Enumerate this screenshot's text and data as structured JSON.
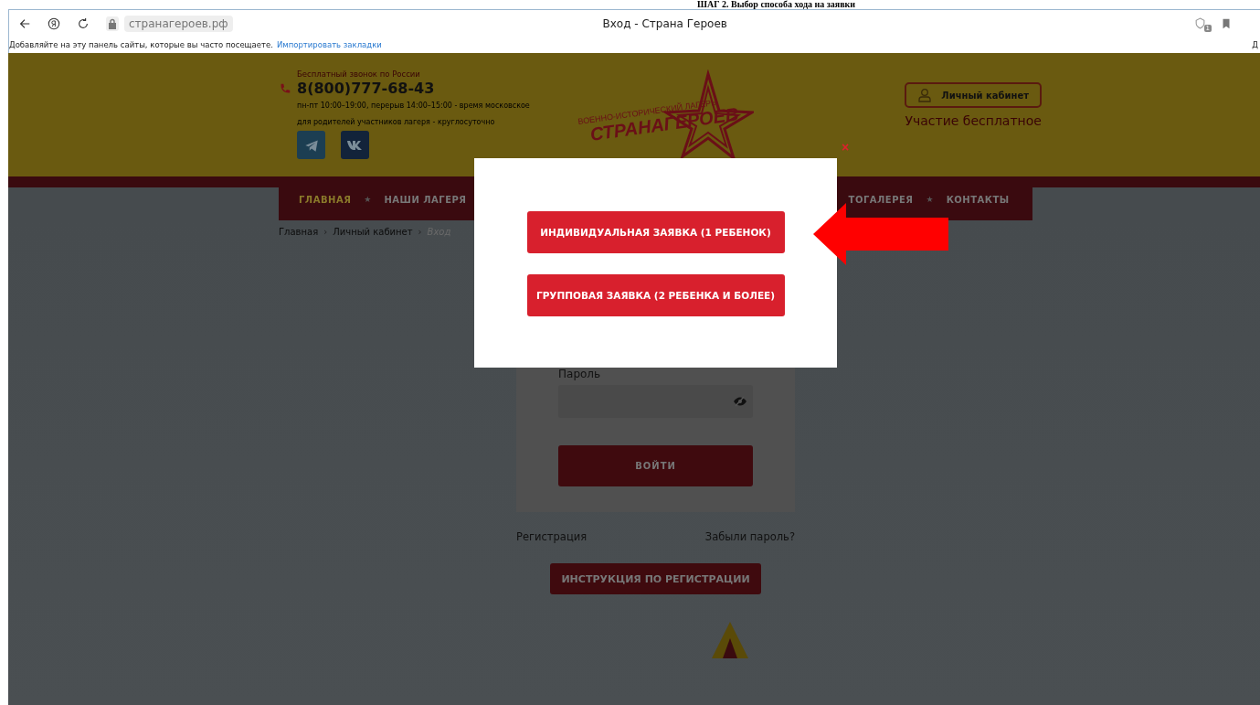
{
  "document_heading": "ШАГ 2. Выбор способа хода на заявки",
  "browser": {
    "url": "странагероев.рф",
    "title": "Вход - Страна Героев",
    "bookmarks_hint": "Добавляйте на эту панель сайты, которые вы часто посещаете.",
    "import_link": "Импортировать закладки",
    "tracker_count": "1",
    "edge_char": "Д"
  },
  "header": {
    "free_call": "Бесплатный звонок по России",
    "phone": "8(800)777-68-43",
    "hours": "пн-пт 10:00–19:00, перерыв 14:00–15:00 - время московское",
    "parents_hours": "для родителей участников лагеря - круглосуточно",
    "logo_top": "ВОЕННО-ИСТОРИЧЕСКИЙ ЛАГЕРЬ",
    "logo_main": "СТРАНАГЕРОЕВ",
    "account_button": "Личный кабинет",
    "free_participation": "Участие бесплатное"
  },
  "nav": [
    {
      "label": "ГЛАВНАЯ",
      "selected": true
    },
    {
      "label": "НАШИ ЛАГЕРЯ",
      "selected": false
    },
    {
      "label": "ТОГАЛЕРЕЯ",
      "selected": false
    },
    {
      "label": "КОНТАКТЫ",
      "selected": false
    }
  ],
  "breadcrumbs": [
    {
      "label": "Главная",
      "current": false
    },
    {
      "label": "Личный кабинет",
      "current": false
    },
    {
      "label": "Вход",
      "current": true
    }
  ],
  "breadcrumb_separator": "›",
  "nav_separator": "★",
  "login": {
    "password_label": "Пароль",
    "submit": "ВОЙТИ",
    "register_link": "Регистрация",
    "forgot_link": "Забыли пароль?",
    "instructions_button": "ИНСТРУКЦИЯ ПО РЕГИСТРАЦИИ"
  },
  "modal": {
    "options": [
      "ИНДИВИДУАЛЬНАЯ ЗАЯВКА (1 РЕБЕНОК)",
      "ГРУППОВАЯ ЗАЯВКА (2 РЕБЕНКА И БОЛЕЕ)"
    ],
    "close": "×"
  }
}
